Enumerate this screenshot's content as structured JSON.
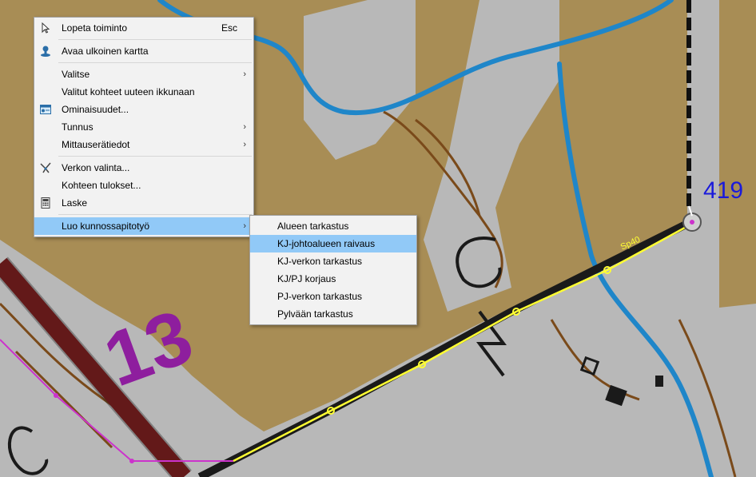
{
  "map": {
    "point_label": "419",
    "area_label": "13",
    "line_label": "Sp40",
    "colors": {
      "terrain_open": "#a88d55",
      "terrain_forest": "#b8b8b8",
      "water": "#1f86c9",
      "road": "#8b1a1a",
      "power_line": "#ffff33",
      "selection_line": "#cc33cc",
      "point_label": "#1a1adb",
      "area_label": "#8e1e9e"
    }
  },
  "context_menu": {
    "items": [
      {
        "label": "Lopeta toiminto",
        "shortcut": "Esc",
        "icon": "cursor-icon"
      },
      {
        "label": "Avaa ulkoinen kartta",
        "icon": "pin-icon"
      },
      {
        "label": "Valitse",
        "submenu": true
      },
      {
        "label": "Valitut kohteet uuteen ikkunaan"
      },
      {
        "label": "Ominaisuudet...",
        "icon": "properties-icon"
      },
      {
        "label": "Tunnus",
        "submenu": true
      },
      {
        "label": "Mittauserätiedot",
        "submenu": true
      },
      {
        "label": "Verkon valinta...",
        "icon": "network-icon"
      },
      {
        "label": "Kohteen tulokset..."
      },
      {
        "label": "Laske",
        "icon": "calculator-icon"
      },
      {
        "label": "Luo kunnossapitotyö",
        "submenu": true,
        "highlighted": true
      }
    ]
  },
  "submenu": {
    "items": [
      {
        "label": "Alueen tarkastus"
      },
      {
        "label": "KJ-johtoalueen raivaus",
        "highlighted": true
      },
      {
        "label": "KJ-verkon tarkastus"
      },
      {
        "label": "KJ/PJ korjaus"
      },
      {
        "label": "PJ-verkon tarkastus"
      },
      {
        "label": "Pylvään tarkastus"
      }
    ]
  }
}
